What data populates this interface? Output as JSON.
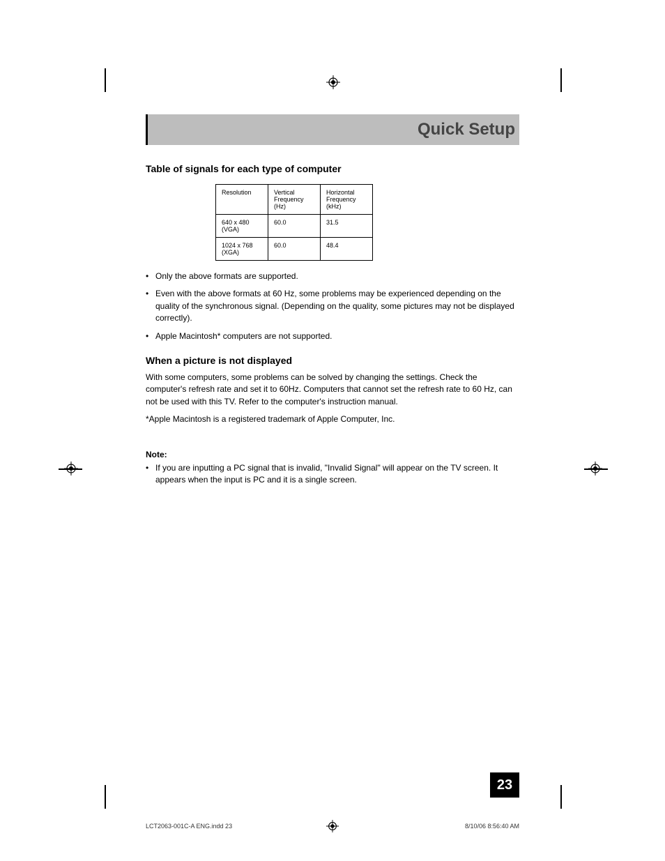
{
  "banner": {
    "title": "Quick Setup"
  },
  "section1": {
    "heading": "Table of signals for each type of computer",
    "table": {
      "headers": [
        "Resolution",
        "Vertical Frequency (Hz)",
        "Horizontal Frequency (kHz)"
      ],
      "rows": [
        [
          "640 x 480 (VGA)",
          "60.0",
          "31.5"
        ],
        [
          "1024 x 768 (XGA)",
          "60.0",
          "48.4"
        ]
      ]
    },
    "bullets": [
      "Only the above formats are supported.",
      "Even with the above formats at 60 Hz, some problems may be experienced depending on the quality of the synchronous signal.  (Depending on the quality, some pictures may not be displayed correctly).",
      "Apple Macintosh* computers are not supported."
    ]
  },
  "section2": {
    "heading": "When a picture is not displayed",
    "para1": "With some computers, some problems can be solved by changing the settings.  Check the computer's refresh rate and set it to 60Hz.  Computers that cannot set the refresh rate to 60 Hz, can not be used with this TV.  Refer to the computer's instruction manual.",
    "para2": "*Apple Macintosh is a registered trademark of Apple Computer, Inc."
  },
  "note": {
    "label": "Note:",
    "bullets": [
      "If you are inputting a PC signal that is invalid, \"Invalid Signal\" will appear on the TV screen.  It appears when the input is PC and it is a single screen."
    ]
  },
  "page_number": "23",
  "footer": {
    "left": "LCT2063-001C-A ENG.indd   23",
    "right": "8/10/06   8:56:40 AM"
  }
}
